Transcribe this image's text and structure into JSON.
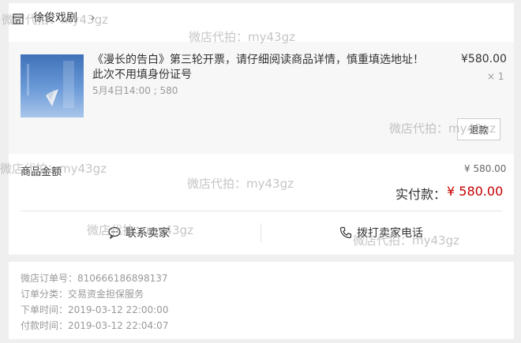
{
  "shop": {
    "name": "徐俊戏剧",
    "chevron": "›"
  },
  "product": {
    "title": "《漫长的告白》第三轮开票，请仔细阅读商品详情，慎重填选地址！ 此次不用填身份证号",
    "subtitle": "5月4日14:00 ; 580",
    "price": "¥580.00",
    "quantity": "× 1",
    "refund_label": "退款"
  },
  "totals": {
    "goods_label": "商品金额",
    "goods_amount": "¥ 580.00",
    "paid_label": "实付款：",
    "paid_value": "¥ 580.00"
  },
  "actions": {
    "contact_seller": "联系卖家",
    "call_seller": "拨打卖家电话"
  },
  "order_info": [
    "微店订单号：810666186898137",
    "订单分类：交易资金担保服务",
    "下单时间：2019-03-12 22:00:00",
    "付款时间：2019-03-12 22:04:07"
  ],
  "watermarks": [
    "微店代拍：my43gz",
    "微店代拍：my43gz",
    "微店代拍：my43gz",
    "微店代拍：my43gz",
    "微店代拍：my43gz",
    "微店代拍：my43gz",
    "微店代拍：my43gz"
  ],
  "icons": {
    "shop": "shop-icon",
    "chevron": "chevron-right-icon",
    "chat": "chat-bubble-icon",
    "phone": "phone-icon"
  },
  "colors": {
    "accent_red": "#c40000",
    "muted_text": "#999999",
    "background": "#efefef"
  }
}
